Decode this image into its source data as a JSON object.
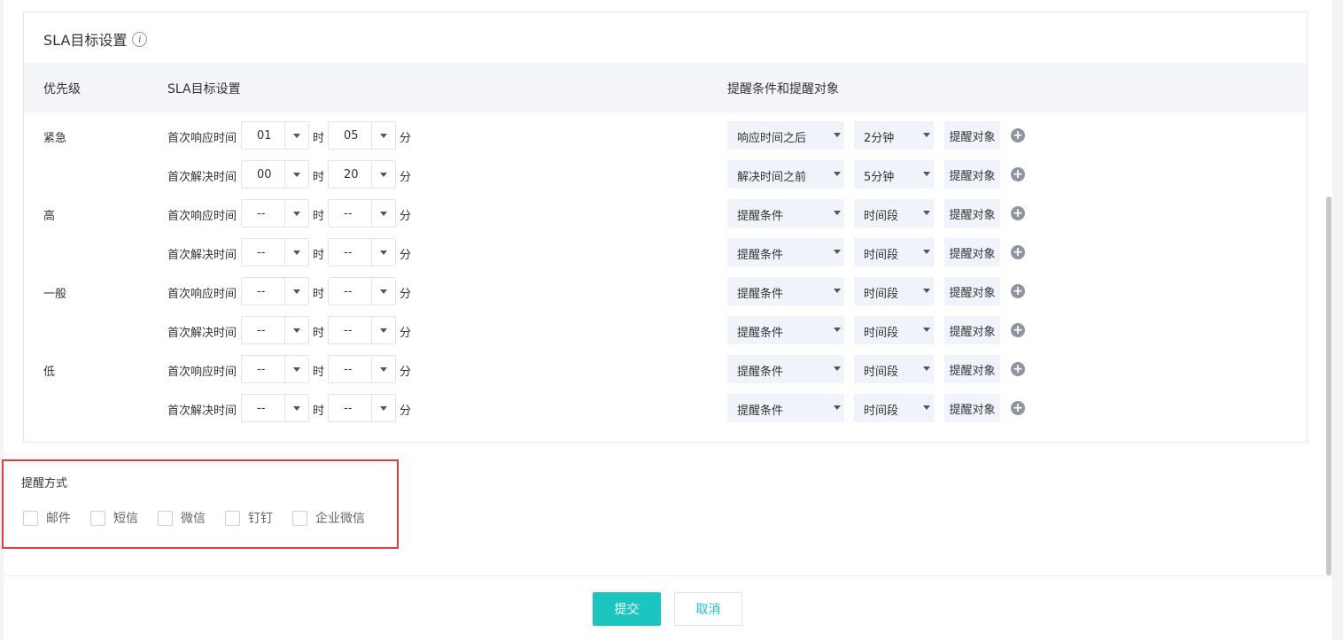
{
  "card": {
    "title": "SLA目标设置",
    "info_glyph": "i"
  },
  "table": {
    "headers": [
      "优先级",
      "SLA目标设置",
      "提醒条件和提醒对象"
    ],
    "hour_unit": "时",
    "minute_unit": "分",
    "remind_button": "提醒对象",
    "add_glyph": "+",
    "priorities": [
      {
        "label": "紧急",
        "rows": [
          {
            "label": "首次响应时间",
            "hour": "01",
            "minute": "05",
            "condition": "响应时间之后",
            "period": "2分钟"
          },
          {
            "label": "首次解决时间",
            "hour": "00",
            "minute": "20",
            "condition": "解决时间之前",
            "period": "5分钟"
          }
        ]
      },
      {
        "label": "高",
        "rows": [
          {
            "label": "首次响应时间",
            "hour": "--",
            "minute": "--",
            "condition": "提醒条件",
            "period": "时间段"
          },
          {
            "label": "首次解决时间",
            "hour": "--",
            "minute": "--",
            "condition": "提醒条件",
            "period": "时间段"
          }
        ]
      },
      {
        "label": "一般",
        "rows": [
          {
            "label": "首次响应时间",
            "hour": "--",
            "minute": "--",
            "condition": "提醒条件",
            "period": "时间段"
          },
          {
            "label": "首次解决时间",
            "hour": "--",
            "minute": "--",
            "condition": "提醒条件",
            "period": "时间段"
          }
        ]
      },
      {
        "label": "低",
        "rows": [
          {
            "label": "首次响应时间",
            "hour": "--",
            "minute": "--",
            "condition": "提醒条件",
            "period": "时间段"
          },
          {
            "label": "首次解决时间",
            "hour": "--",
            "minute": "--",
            "condition": "提醒条件",
            "period": "时间段"
          }
        ]
      }
    ]
  },
  "notify": {
    "title": "提醒方式",
    "options": [
      "邮件",
      "短信",
      "微信",
      "钉钉",
      "企业微信"
    ]
  },
  "footer": {
    "submit": "提交",
    "cancel": "取消"
  },
  "colors": {
    "accent": "#1bc6c1",
    "highlight_border": "#e23b3b",
    "header_bg": "#f3f5f9"
  }
}
